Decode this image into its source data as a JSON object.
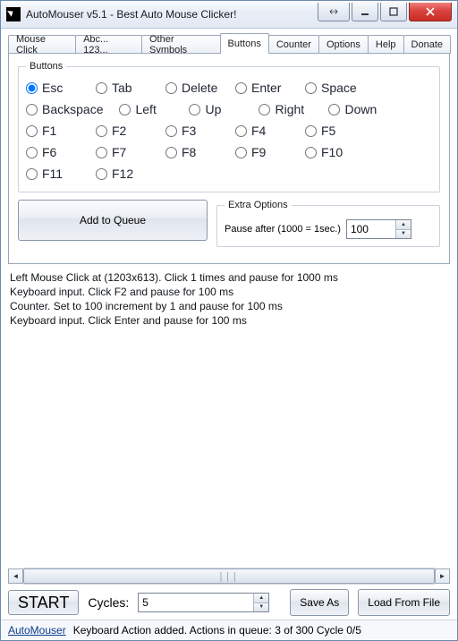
{
  "window": {
    "title": "AutoMouser v5.1 - Best Auto Mouse Clicker!"
  },
  "tabs": {
    "items": [
      {
        "label": "Mouse Click"
      },
      {
        "label": "Abc... 123..."
      },
      {
        "label": "Other Symbols"
      },
      {
        "label": "Buttons"
      },
      {
        "label": "Counter"
      },
      {
        "label": "Options"
      },
      {
        "label": "Help"
      },
      {
        "label": "Donate"
      }
    ],
    "active_index": 3
  },
  "buttons_group": {
    "legend": "Buttons",
    "options": [
      "Esc",
      "Tab",
      "Delete",
      "Enter",
      "Space",
      "Backspace",
      "Left",
      "Up",
      "Right",
      "Down",
      "F1",
      "F2",
      "F3",
      "F4",
      "F5",
      "F6",
      "F7",
      "F8",
      "F9",
      "F10",
      "F11",
      "F12"
    ],
    "selected": "Esc"
  },
  "add_to_queue_label": "Add to Queue",
  "extra_options": {
    "legend": "Extra Options",
    "pause_label": "Pause after (1000 = 1sec.)",
    "pause_value": "100"
  },
  "queue": [
    "Left Mouse Click at  (1203x613). Click 1 times and pause for 1000 ms",
    "Keyboard input. Click F2 and pause for 100 ms",
    "Counter. Set to 100 increment by 1 and pause for 100 ms",
    "Keyboard input. Click Enter and pause for 100 ms"
  ],
  "bottom": {
    "start_label": "START",
    "cycles_label": "Cycles:",
    "cycles_value": "5",
    "save_as_label": "Save As",
    "load_label": "Load From File"
  },
  "status": {
    "link": "AutoMouser",
    "text": "Keyboard Action added. Actions in queue: 3 of 300   Cycle 0/5"
  }
}
